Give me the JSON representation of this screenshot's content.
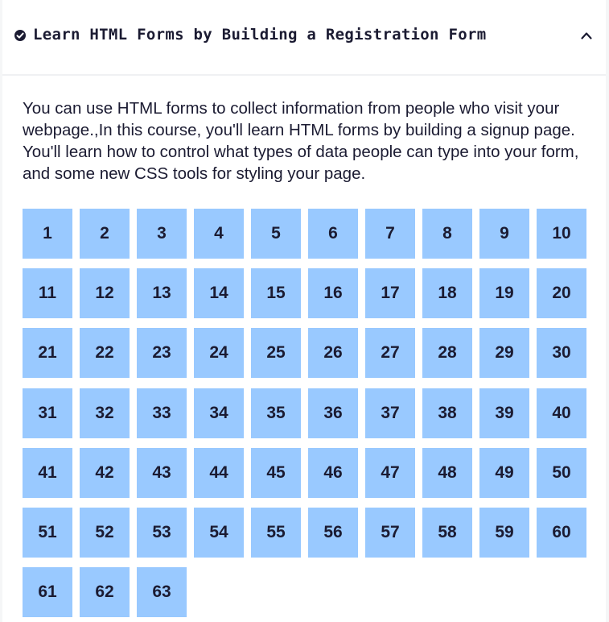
{
  "block": {
    "title": "Learn HTML Forms by Building a Registration Form",
    "status_icon": "check-circle-icon",
    "toggle_icon": "chevron-up-icon",
    "description": "You can use HTML forms to collect information from people who visit your webpage.,In this course, you'll learn HTML forms by building a signup page. You'll learn how to control what types of data people can type into your form, and some new CSS tools for styling your page."
  },
  "steps": [
    "1",
    "2",
    "3",
    "4",
    "5",
    "6",
    "7",
    "8",
    "9",
    "10",
    "11",
    "12",
    "13",
    "14",
    "15",
    "16",
    "17",
    "18",
    "19",
    "20",
    "21",
    "22",
    "23",
    "24",
    "25",
    "26",
    "27",
    "28",
    "29",
    "30",
    "31",
    "32",
    "33",
    "34",
    "35",
    "36",
    "37",
    "38",
    "39",
    "40",
    "41",
    "42",
    "43",
    "44",
    "45",
    "46",
    "47",
    "48",
    "49",
    "50",
    "51",
    "52",
    "53",
    "54",
    "55",
    "56",
    "57",
    "58",
    "59",
    "60",
    "61",
    "62",
    "63"
  ],
  "colors": {
    "step_background": "#99c9ff",
    "text": "#1b1b32",
    "panel": "#ffffff",
    "page_background": "#f5f6f7"
  }
}
